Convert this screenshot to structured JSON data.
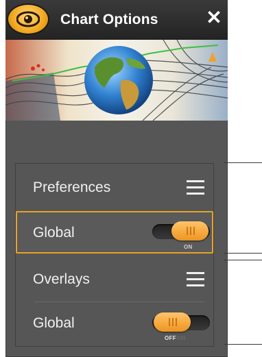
{
  "header": {
    "title": "Chart Options",
    "close_label": "✕"
  },
  "sections": [
    {
      "label": "Preferences",
      "menu_icon": "hamburger-menu-icon"
    },
    {
      "label": "Overlays",
      "menu_icon": "hamburger-menu-icon"
    }
  ],
  "preferences_global": {
    "label": "Global",
    "toggle_on_text": "ON",
    "state": "on"
  },
  "overlays_global": {
    "label": "Global",
    "toggle_off_text": "OFF",
    "toggle_on_text": "ON",
    "state": "off"
  },
  "colors": {
    "accent": "#e8a324",
    "panel": "#565656",
    "titlebar": "#2a2a2a",
    "text": "#f0f0f0"
  }
}
